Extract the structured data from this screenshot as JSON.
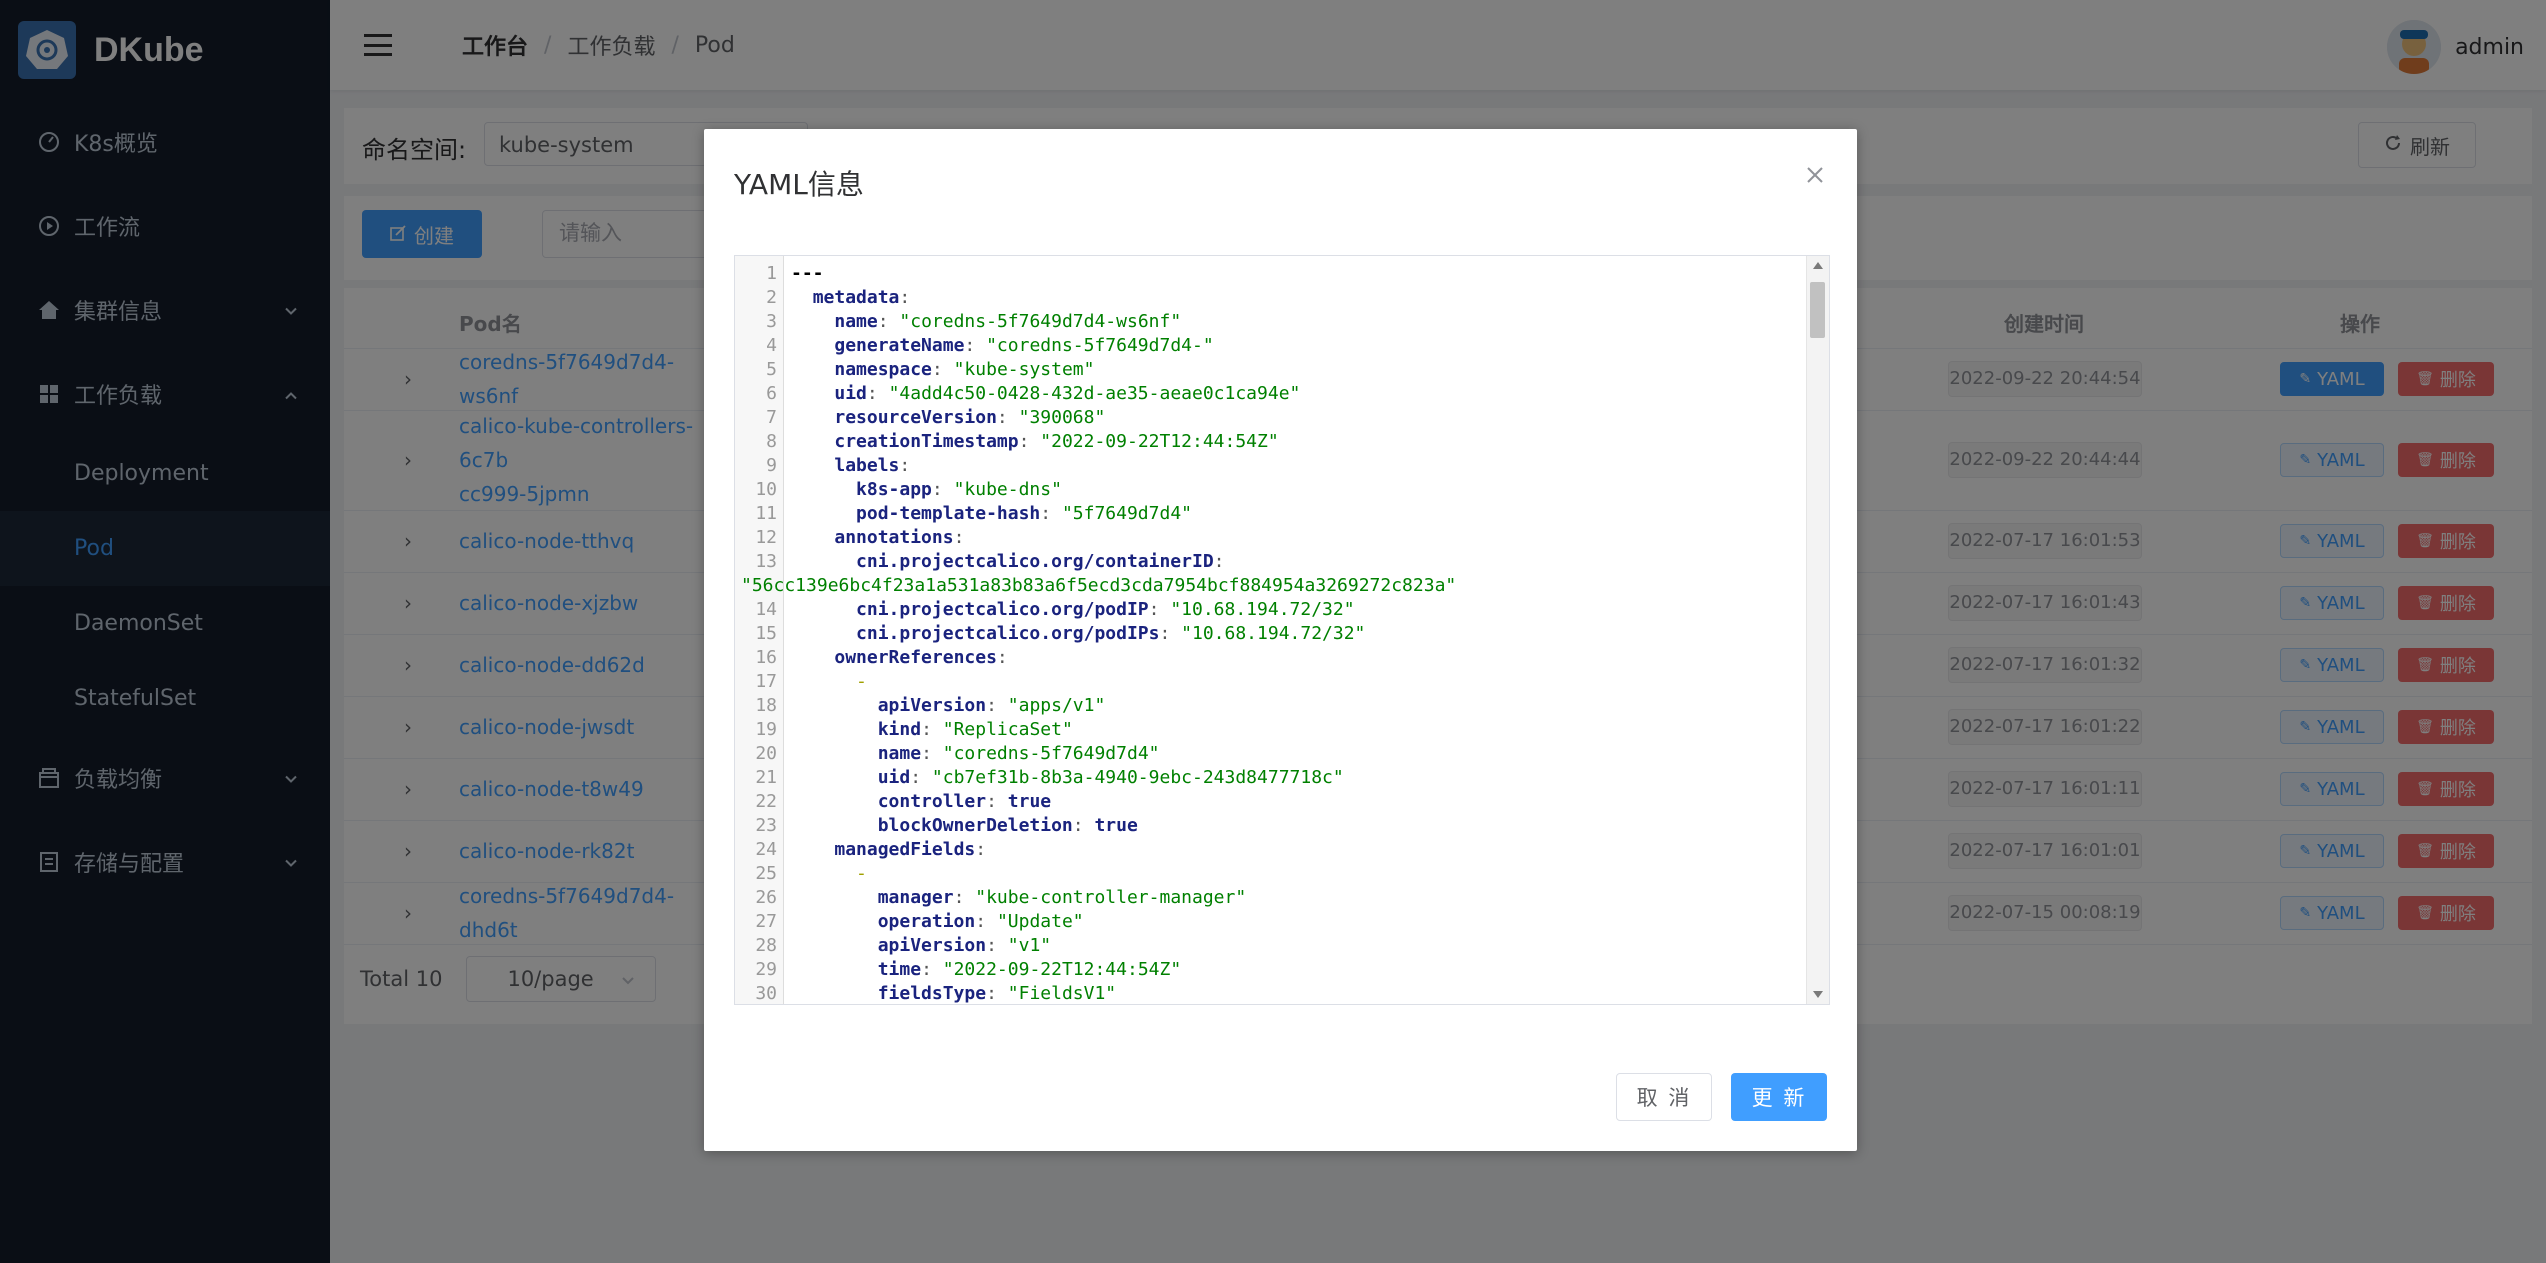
{
  "app": {
    "name": "DKube"
  },
  "sidebar": {
    "items": [
      {
        "label": "K8s概览",
        "icon": "gauge-icon"
      },
      {
        "label": "工作流",
        "icon": "play-circle-icon"
      },
      {
        "label": "集群信息",
        "icon": "home-icon"
      },
      {
        "label": "工作负载",
        "icon": "grid-icon"
      },
      {
        "label": "负载均衡",
        "icon": "box-icon"
      },
      {
        "label": "存储与配置",
        "icon": "document-icon"
      }
    ],
    "sub_items": [
      "Deployment",
      "Pod",
      "DaemonSet",
      "StatefulSet"
    ],
    "active_sub": "Pod"
  },
  "header": {
    "breadcrumb": [
      "工作台",
      "工作负载",
      "Pod"
    ],
    "user": "admin"
  },
  "filter": {
    "namespace_label": "命名空间:",
    "namespace_value": "kube-system",
    "refresh_label": "刷新"
  },
  "toolbar": {
    "create_label": "创建",
    "search_placeholder": "请输入"
  },
  "table": {
    "headers": {
      "pod": "Pod名",
      "time": "创建时间",
      "op": "操作"
    },
    "rows": [
      {
        "name": "coredns-5f7649d7d4-ws6nf",
        "time": "2022-09-22 20:44:54",
        "yaml": "YAML",
        "del": "删除"
      },
      {
        "name": "calico-kube-controllers-6c7b\ncc999-5jpmn",
        "time": "2022-09-22 20:44:44",
        "yaml": "YAML",
        "del": "删除"
      },
      {
        "name": "calico-node-tthvq",
        "time": "2022-07-17 16:01:53",
        "yaml": "YAML",
        "del": "删除"
      },
      {
        "name": "calico-node-xjzbw",
        "time": "2022-07-17 16:01:43",
        "yaml": "YAML",
        "del": "删除"
      },
      {
        "name": "calico-node-dd62d",
        "time": "2022-07-17 16:01:32",
        "yaml": "YAML",
        "del": "删除"
      },
      {
        "name": "calico-node-jwsdt",
        "time": "2022-07-17 16:01:22",
        "yaml": "YAML",
        "del": "删除"
      },
      {
        "name": "calico-node-t8w49",
        "time": "2022-07-17 16:01:11",
        "yaml": "YAML",
        "del": "删除"
      },
      {
        "name": "calico-node-rk82t",
        "time": "2022-07-17 16:01:01",
        "yaml": "YAML",
        "del": "删除"
      },
      {
        "name": "coredns-5f7649d7d4-dhd6t",
        "time": "2022-07-15 00:08:19",
        "yaml": "YAML",
        "del": "删除"
      }
    ]
  },
  "pagination": {
    "total": "Total 10",
    "page_size": "10/page"
  },
  "dialog": {
    "title": "YAML信息",
    "cancel_label": "取 消",
    "update_label": "更 新",
    "lines": [
      {
        "n": "1",
        "i": 0,
        "k": "---",
        "t": "doc"
      },
      {
        "n": "2",
        "i": 2,
        "k": "metadata",
        "v": ""
      },
      {
        "n": "3",
        "i": 4,
        "k": "name",
        "v": "\"coredns-5f7649d7d4-ws6nf\""
      },
      {
        "n": "4",
        "i": 4,
        "k": "generateName",
        "v": "\"coredns-5f7649d7d4-\""
      },
      {
        "n": "5",
        "i": 4,
        "k": "namespace",
        "v": "\"kube-system\""
      },
      {
        "n": "6",
        "i": 4,
        "k": "uid",
        "v": "\"4add4c50-0428-432d-ae35-aeae0c1ca94e\""
      },
      {
        "n": "7",
        "i": 4,
        "k": "resourceVersion",
        "v": "\"390068\""
      },
      {
        "n": "8",
        "i": 4,
        "k": "creationTimestamp",
        "v": "\"2022-09-22T12:44:54Z\""
      },
      {
        "n": "9",
        "i": 4,
        "k": "labels",
        "v": ""
      },
      {
        "n": "10",
        "i": 6,
        "k": "k8s-app",
        "v": "\"kube-dns\""
      },
      {
        "n": "11",
        "i": 6,
        "k": "pod-template-hash",
        "v": "\"5f7649d7d4\""
      },
      {
        "n": "12",
        "i": 4,
        "k": "annotations",
        "v": ""
      },
      {
        "n": "13",
        "i": 6,
        "k": "cni.projectcalico.org/containerID",
        "v": ""
      },
      {
        "n": "",
        "i": 0,
        "k": "",
        "v": "\"56cc139e6bc4f23a1a531a83b83a6f5ecd3cda7954bcf884954a3269272c823a\"",
        "t": "cont"
      },
      {
        "n": "14",
        "i": 6,
        "k": "cni.projectcalico.org/podIP",
        "v": "\"10.68.194.72/32\""
      },
      {
        "n": "15",
        "i": 6,
        "k": "cni.projectcalico.org/podIPs",
        "v": "\"10.68.194.72/32\""
      },
      {
        "n": "16",
        "i": 4,
        "k": "ownerReferences",
        "v": ""
      },
      {
        "n": "17",
        "i": 6,
        "k": "-",
        "t": "dash"
      },
      {
        "n": "18",
        "i": 8,
        "k": "apiVersion",
        "v": "\"apps/v1\""
      },
      {
        "n": "19",
        "i": 8,
        "k": "kind",
        "v": "\"ReplicaSet\""
      },
      {
        "n": "20",
        "i": 8,
        "k": "name",
        "v": "\"coredns-5f7649d7d4\""
      },
      {
        "n": "21",
        "i": 8,
        "k": "uid",
        "v": "\"cb7ef31b-8b3a-4940-9ebc-243d8477718c\""
      },
      {
        "n": "22",
        "i": 8,
        "k": "controller",
        "v": "true",
        "t": "bool"
      },
      {
        "n": "23",
        "i": 8,
        "k": "blockOwnerDeletion",
        "v": "true",
        "t": "bool"
      },
      {
        "n": "24",
        "i": 4,
        "k": "managedFields",
        "v": ""
      },
      {
        "n": "25",
        "i": 6,
        "k": "-",
        "t": "dash"
      },
      {
        "n": "26",
        "i": 8,
        "k": "manager",
        "v": "\"kube-controller-manager\""
      },
      {
        "n": "27",
        "i": 8,
        "k": "operation",
        "v": "\"Update\""
      },
      {
        "n": "28",
        "i": 8,
        "k": "apiVersion",
        "v": "\"v1\""
      },
      {
        "n": "29",
        "i": 8,
        "k": "time",
        "v": "\"2022-09-22T12:44:54Z\""
      },
      {
        "n": "30",
        "i": 8,
        "k": "fieldsType",
        "v": "\"FieldsV1\""
      }
    ]
  },
  "colors": {
    "accent": "#409eff",
    "danger": "#f56c6c",
    "sidebar_bg": "#141d2b"
  }
}
